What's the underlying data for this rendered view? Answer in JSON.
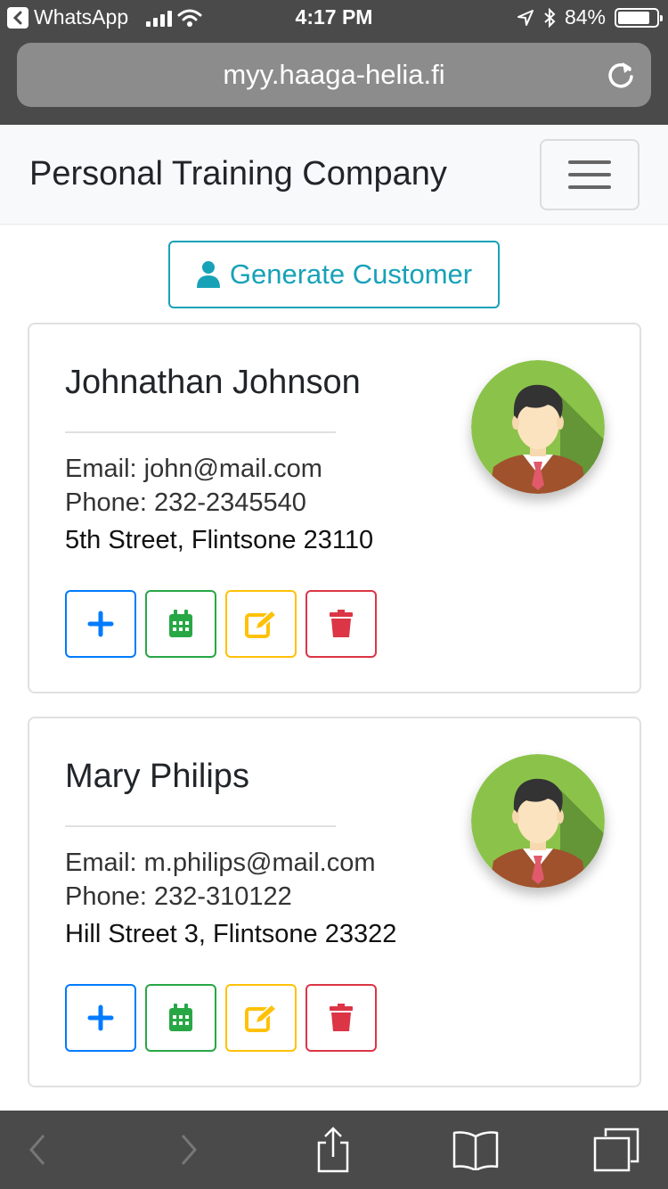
{
  "status_bar": {
    "back_app": "WhatsApp",
    "time": "4:17 PM",
    "battery": "84%",
    "battery_level": 0.84
  },
  "browser": {
    "url": "myy.haaga-helia.fi"
  },
  "navbar": {
    "brand": "Personal Training Company"
  },
  "main": {
    "generate_label": "Generate Customer",
    "customers": [
      {
        "name": "Johnathan Johnson",
        "email": "Email: john@mail.com",
        "phone": "Phone: 232-2345540",
        "address": "5th Street, Flintsone 23110"
      },
      {
        "name": "Mary Philips",
        "email": "Email: m.philips@mail.com",
        "phone": "Phone: 232-310122",
        "address": "Hill Street 3, Flintsone 23322"
      }
    ]
  },
  "icons": {
    "add": "plus-icon",
    "training": "calendar-icon",
    "edit": "edit-icon",
    "delete": "trash-icon",
    "avatar": "user-avatar"
  },
  "colors": {
    "info": "#17a2b8",
    "primary": "#007bff",
    "success": "#28a745",
    "warning": "#ffc107",
    "danger": "#dc3545",
    "chrome": "#4a4a4a"
  }
}
